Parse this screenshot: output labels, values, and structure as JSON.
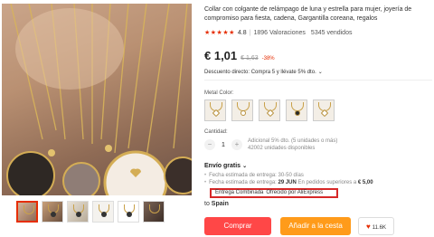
{
  "product": {
    "title": "Collar con colgante de relámpago de luna y estrella para mujer, joyería de compromiso para fiesta, cadena, Gargantilla coreana, regalos",
    "stars": "★★★★★",
    "rating": "4.8",
    "separator": "|",
    "reviews": "1896 Valoraciones",
    "sold": "5345 vendidos"
  },
  "price": {
    "current": "€ 1,01",
    "original": "€ 1,63",
    "discount": "-38%"
  },
  "promo": {
    "text": "Descuento directo: Compra 5 y llévate 5% dto.",
    "chevron_icon": "chevron-down-icon",
    "chevron": "⌄"
  },
  "variants": {
    "label": "Metal Color:",
    "swatch_icons": [
      "lightning-pendant-icon",
      "moon-pendant-icon",
      "star-pendant-icon",
      "dark-pendant-icon",
      "star-pendant-icon"
    ]
  },
  "quantity": {
    "label": "Cantidad:",
    "minus": "−",
    "value": "1",
    "plus": "+",
    "note_line1": "Adicional 5% dto. (5 unidades o más)",
    "note_line2": "42002 unidades disponibles"
  },
  "shipping": {
    "title": "Envío gratis",
    "chevron": "⌄",
    "bullet": "•",
    "line1": "Fecha estimada de entrega: 30-50 días",
    "line2_prefix": "Fecha estimada de entrega:",
    "line2_date": "29 JUN",
    "line2_mid": "En pedidos superiores a",
    "line2_price": "€ 5,00",
    "combined_main": "Entrega Combinada",
    "combined_sub": "Ofrecido por AliExpress",
    "to_prefix": "to",
    "to_country": "Spain"
  },
  "actions": {
    "buy": "Comprar",
    "cart": "Añadir a la cesta",
    "wishlist_count": "11.6K",
    "heart": "♥"
  },
  "colors": {
    "accent": "#e62e04",
    "buy_button": "#ff4747",
    "cart_button": "#ff9b1a",
    "highlight_box": "#d62828"
  }
}
